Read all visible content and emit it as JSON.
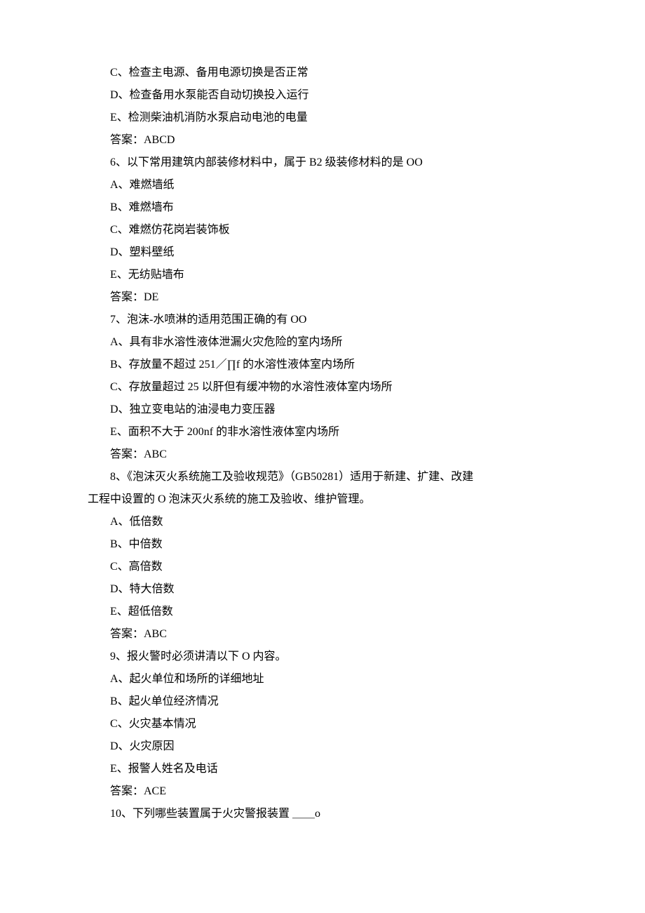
{
  "lines": [
    {
      "indent": true,
      "text": "C、检查主电源、备用电源切换是否正常"
    },
    {
      "indent": true,
      "text": "D、检查备用水泵能否自动切换投入运行"
    },
    {
      "indent": true,
      "text": "E、检测柴油机消防水泵启动电池的电量"
    },
    {
      "indent": true,
      "text": "答案：ABCD"
    },
    {
      "indent": true,
      "text": "6、以下常用建筑内部装修材料中，属于 B2 级装修材料的是 OO"
    },
    {
      "indent": true,
      "text": "A、难燃墙纸"
    },
    {
      "indent": true,
      "text": "B、难燃墙布"
    },
    {
      "indent": true,
      "text": "C、难燃仿花岗岩装饰板"
    },
    {
      "indent": true,
      "text": "D、塑料壁纸"
    },
    {
      "indent": true,
      "text": "E、无纺贴墙布"
    },
    {
      "indent": true,
      "text": "答案：DE"
    },
    {
      "indent": true,
      "text": "7、泡沫-水喷淋的适用范围正确的有 OO"
    },
    {
      "indent": true,
      "text": "A、具有非水溶性液体泄漏火灾危险的室内场所"
    },
    {
      "indent": true,
      "text": "B、存放量不超过 251／∏f 的水溶性液体室内场所"
    },
    {
      "indent": true,
      "text": "C、存放量超过 25 以肝但有缓冲物的水溶性液体室内场所"
    },
    {
      "indent": true,
      "text": "D、独立变电站的油浸电力变压器"
    },
    {
      "indent": true,
      "text": "E、面积不大于 200nf 的非水溶性液体室内场所"
    },
    {
      "indent": true,
      "text": "答案：ABC"
    },
    {
      "indent": true,
      "text": "8、《泡沫灭火系统施工及验收规范》（GB50281）适用于新建、扩建、改建"
    },
    {
      "indent": false,
      "text": "工程中设置的 O 泡沫灭火系统的施工及验收、维护管理。"
    },
    {
      "indent": true,
      "text": "A、低倍数"
    },
    {
      "indent": true,
      "text": "B、中倍数"
    },
    {
      "indent": true,
      "text": "C、高倍数"
    },
    {
      "indent": true,
      "text": "D、特大倍数"
    },
    {
      "indent": true,
      "text": "E、超低倍数"
    },
    {
      "indent": true,
      "text": "答案：ABC"
    },
    {
      "indent": true,
      "text": "9、报火警时必须讲清以下 O 内容。"
    },
    {
      "indent": true,
      "text": "A、起火单位和场所的详细地址"
    },
    {
      "indent": true,
      "text": "B、起火单位经济情况"
    },
    {
      "indent": true,
      "text": "C、火灾基本情况"
    },
    {
      "indent": true,
      "text": "D、火灾原因"
    },
    {
      "indent": true,
      "text": "E、报警人姓名及电话"
    },
    {
      "indent": true,
      "text": "答案：ACE"
    },
    {
      "indent": true,
      "text": "10、下列哪些装置属于火灾警报装置 ＿＿o"
    }
  ]
}
